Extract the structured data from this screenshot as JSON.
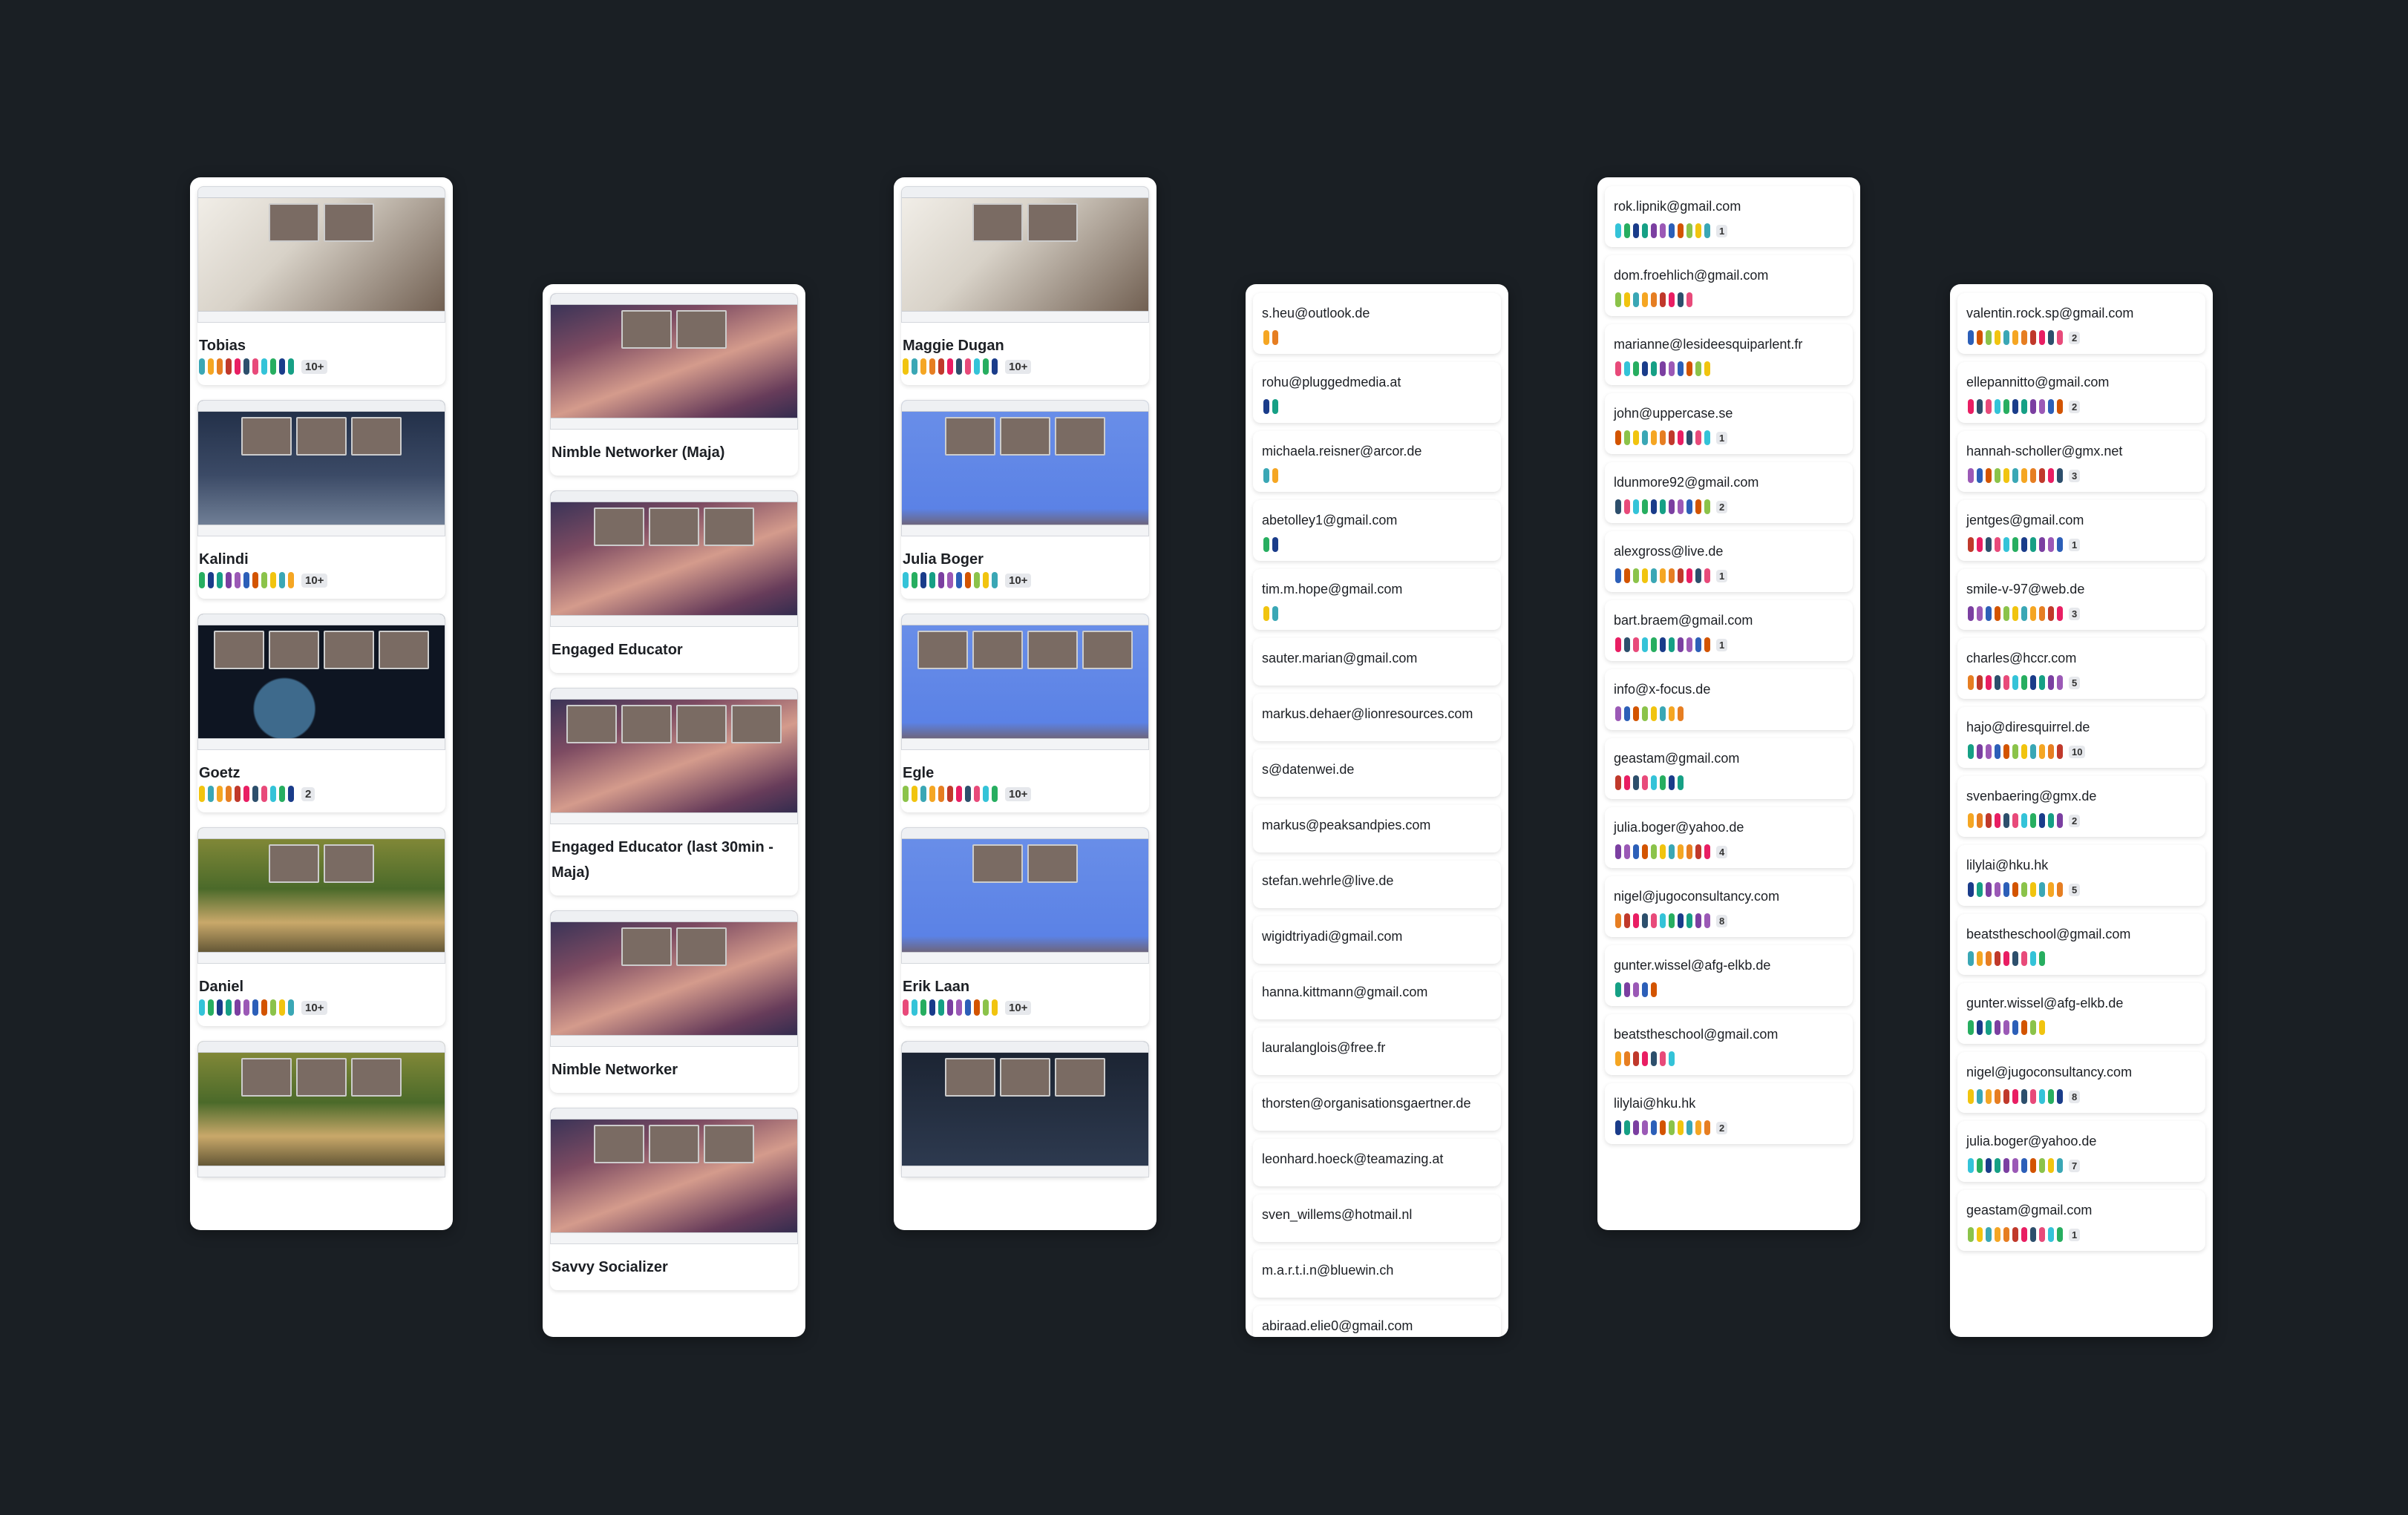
{
  "colors": [
    "#3aa7b5",
    "#e84a7a",
    "#9b59b6",
    "#f5a623",
    "#34c3d8",
    "#2c5fb8",
    "#e67e22",
    "#27ae60",
    "#d35400",
    "#c0392b",
    "#1a3c8a",
    "#8bc34a",
    "#e91e63",
    "#16a085",
    "#f1c40f",
    "#2d4f6c",
    "#7b3fa1"
  ],
  "columns": [
    {
      "type": "sessions",
      "items": [
        {
          "title": "Tobias",
          "badge": "10+",
          "bg": "video"
        },
        {
          "title": "Kalindi",
          "badge": "10+",
          "bg": "night"
        },
        {
          "title": "Goetz",
          "badge": "2",
          "bg": "space"
        },
        {
          "title": "Daniel",
          "badge": "10+",
          "bg": "forest"
        },
        {
          "title": "",
          "badge": "",
          "bg": "forest"
        }
      ]
    },
    {
      "type": "sessions",
      "items": [
        {
          "title": "Nimble Networker (Maja)",
          "badge": "",
          "bg": "canyon"
        },
        {
          "title": "Engaged Educator",
          "badge": "",
          "bg": "canyon"
        },
        {
          "title": "Engaged Educator (last 30min - Maja)",
          "badge": "",
          "bg": "canyon"
        },
        {
          "title": "Nimble Networker",
          "badge": "",
          "bg": "canyon"
        },
        {
          "title": "Savvy Socializer",
          "badge": "",
          "bg": "canyon"
        }
      ]
    },
    {
      "type": "sessions",
      "items": [
        {
          "title": "Maggie Dugan",
          "badge": "10+",
          "bg": "video"
        },
        {
          "title": "Julia Boger",
          "badge": "10+",
          "bg": "game"
        },
        {
          "title": "Egle",
          "badge": "10+",
          "bg": "game"
        },
        {
          "title": "Erik Laan",
          "badge": "10+",
          "bg": "game"
        },
        {
          "title": "",
          "badge": "",
          "bg": "dark"
        }
      ]
    },
    {
      "type": "emails",
      "items": [
        {
          "email": "s.heu@outlook.de",
          "dots": 2
        },
        {
          "email": "rohu@pluggedmedia.at",
          "dots": 2
        },
        {
          "email": "michaela.reisner@arcor.de",
          "dots": 2
        },
        {
          "email": "abetolley1@gmail.com",
          "dots": 2
        },
        {
          "email": "tim.m.hope@gmail.com",
          "dots": 2
        },
        {
          "email": "sauter.marian@gmail.com",
          "dots": 0
        },
        {
          "email": "markus.dehaer@lionresources.com",
          "dots": 0
        },
        {
          "email": "s@datenwei.de",
          "dots": 0
        },
        {
          "email": "markus@peaksandpies.com",
          "dots": 0
        },
        {
          "email": "stefan.wehrle@live.de",
          "dots": 0
        },
        {
          "email": "wigidtriyadi@gmail.com",
          "dots": 0
        },
        {
          "email": "hanna.kittmann@gmail.com",
          "dots": 0
        },
        {
          "email": "lauralanglois@free.fr",
          "dots": 0
        },
        {
          "email": "thorsten@organisationsgaertner.de",
          "dots": 0
        },
        {
          "email": "leonhard.hoeck@teamazing.at",
          "dots": 0
        },
        {
          "email": "sven_willems@hotmail.nl",
          "dots": 0
        },
        {
          "email": "m.a.r.t.i.n@bluewin.ch",
          "dots": 0
        },
        {
          "email": "abiraad.elie0@gmail.com",
          "dots": 0
        }
      ]
    },
    {
      "type": "emails",
      "items": [
        {
          "email": "rok.lipnik@gmail.com",
          "dots": 11,
          "badge": "1"
        },
        {
          "email": "dom.froehlich@gmail.com",
          "dots": 9
        },
        {
          "email": "marianne@lesideesquiparlent.fr",
          "dots": 11
        },
        {
          "email": "john@uppercase.se",
          "dots": 11,
          "badge": "1"
        },
        {
          "email": "ldunmore92@gmail.com",
          "dots": 11,
          "badge": "2"
        },
        {
          "email": "alexgross@live.de",
          "dots": 11,
          "badge": "1"
        },
        {
          "email": "bart.braem@gmail.com",
          "dots": 11,
          "badge": "1"
        },
        {
          "email": "info@x-focus.de",
          "dots": 8
        },
        {
          "email": "geastam@gmail.com",
          "dots": 8
        },
        {
          "email": "julia.boger@yahoo.de",
          "dots": 11,
          "badge": "4"
        },
        {
          "email": "nigel@jugoconsultancy.com",
          "dots": 11,
          "badge": "8"
        },
        {
          "email": "gunter.wissel@afg-elkb.de",
          "dots": 5
        },
        {
          "email": "beatstheschool@gmail.com",
          "dots": 7
        },
        {
          "email": "lilylai@hku.hk",
          "dots": 11,
          "badge": "2"
        }
      ]
    },
    {
      "type": "emails",
      "items": [
        {
          "email": "valentin.rock.sp@gmail.com",
          "dots": 11,
          "badge": "2"
        },
        {
          "email": "ellepannitto@gmail.com",
          "dots": 11,
          "badge": "2"
        },
        {
          "email": "hannah-scholler@gmx.net",
          "dots": 11,
          "badge": "3"
        },
        {
          "email": "jentges@gmail.com",
          "dots": 11,
          "badge": "1"
        },
        {
          "email": "smile-v-97@web.de",
          "dots": 11,
          "badge": "3"
        },
        {
          "email": "charles@hccr.com",
          "dots": 11,
          "badge": "5"
        },
        {
          "email": "hajo@diresquirrel.de",
          "dots": 11,
          "badge": "10"
        },
        {
          "email": "svenbaering@gmx.de",
          "dots": 11,
          "badge": "2"
        },
        {
          "email": "lilylai@hku.hk",
          "dots": 11,
          "badge": "5"
        },
        {
          "email": "beatstheschool@gmail.com",
          "dots": 9
        },
        {
          "email": "gunter.wissel@afg-elkb.de",
          "dots": 9
        },
        {
          "email": "nigel@jugoconsultancy.com",
          "dots": 11,
          "badge": "8"
        },
        {
          "email": "julia.boger@yahoo.de",
          "dots": 11,
          "badge": "7"
        },
        {
          "email": "geastam@gmail.com",
          "dots": 11,
          "badge": "1"
        }
      ]
    }
  ]
}
